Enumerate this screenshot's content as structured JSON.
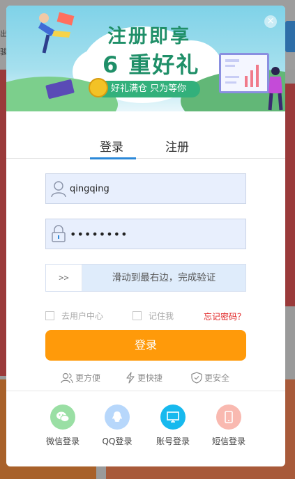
{
  "background": {
    "left_fragments": [
      "出",
      "骏"
    ]
  },
  "banner": {
    "headline_line1": "注册即享",
    "headline_line2": "6 重好礼",
    "pill_text": "好礼满仓 只为等你",
    "close_symbol": "×"
  },
  "tabs": {
    "login": "登录",
    "register": "注册",
    "active": "登录"
  },
  "form": {
    "username_value": "qingqing",
    "password_value": "••••••••",
    "slider_handle": ">>",
    "slider_label": "滑动到最右边，完成验证",
    "user_center_label": "去用户中心",
    "remember_label": "记住我",
    "forgot_label": "忘记密码？",
    "login_button": "登录"
  },
  "features": [
    "更方便",
    "更快捷",
    "更安全"
  ],
  "social": {
    "wechat": "微信登录",
    "qq": "QQ登录",
    "account": "账号登录",
    "sms": "短信登录"
  },
  "colors": {
    "accent_blue": "#2b88d8",
    "login_orange": "#ff9a0a",
    "forgot_red": "#e02020",
    "wechat_green": "#9adfa4",
    "qq_blue": "#b7d7fb",
    "account_cyan": "#17b9ee",
    "sms_pink": "#f9b9b0"
  },
  "icons": {
    "wechat": "wechat-icon",
    "qq": "qq-penguin-icon",
    "account": "monitor-icon",
    "sms": "phone-icon",
    "user": "user-icon",
    "lock": "lock-icon",
    "people": "people-icon",
    "lightning": "lightning-icon",
    "shield": "shield-check-icon"
  }
}
